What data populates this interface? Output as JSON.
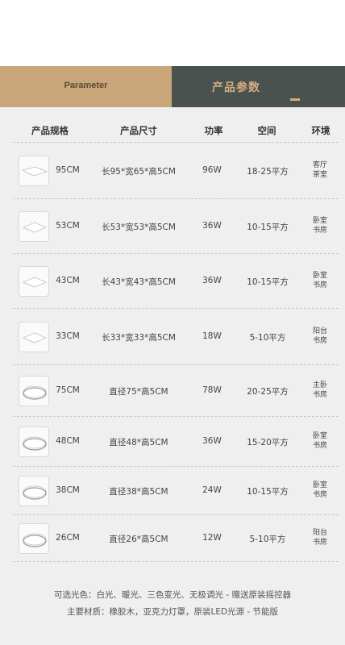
{
  "banner": {
    "en_title": "Parameter",
    "cn_title": "产品参数"
  },
  "headers": [
    "产品规格",
    "产品尺寸",
    "功率",
    "空间",
    "环境"
  ],
  "rows": [
    {
      "spec": "95CM",
      "size": "长95*宽65*高5CM",
      "power": "96W",
      "space": "18-25平方",
      "env": [
        "客厅",
        "茶室"
      ],
      "shape": "rect-wide"
    },
    {
      "spec": "53CM",
      "size": "长53*宽53*高5CM",
      "power": "36W",
      "space": "10-15平方",
      "env": [
        "卧室",
        "书房"
      ],
      "shape": "square"
    },
    {
      "spec": "43CM",
      "size": "长43*宽43*高5CM",
      "power": "36W",
      "space": "10-15平方",
      "env": [
        "卧室",
        "书房"
      ],
      "shape": "square"
    },
    {
      "spec": "33CM",
      "size": "长33*宽33*高5CM",
      "power": "18W",
      "space": "5-10平方",
      "env": [
        "阳台",
        "书房"
      ],
      "shape": "square"
    },
    {
      "spec": "75CM",
      "size": "直径75*高5CM",
      "power": "78W",
      "space": "20-25平方",
      "env": [
        "主卧",
        "书房"
      ],
      "shape": "round"
    },
    {
      "spec": "48CM",
      "size": "直径48*高5CM",
      "power": "36W",
      "space": "15-20平方",
      "env": [
        "卧室",
        "书房"
      ],
      "shape": "round"
    },
    {
      "spec": "38CM",
      "size": "直径38*高5CM",
      "power": "24W",
      "space": "10-15平方",
      "env": [
        "卧室",
        "书房"
      ],
      "shape": "round"
    },
    {
      "spec": "26CM",
      "size": "直径26*高5CM",
      "power": "12W",
      "space": "5-10平方",
      "env": [
        "阳台",
        "书房"
      ],
      "shape": "round"
    }
  ],
  "footer": {
    "line1": "可选光色：白光、暖光、三色变光、无极调光 - 赠送原装摇控器",
    "line2": "主要材质：橡胶木，亚克力灯罩，原装LED光源 - 节能版"
  }
}
